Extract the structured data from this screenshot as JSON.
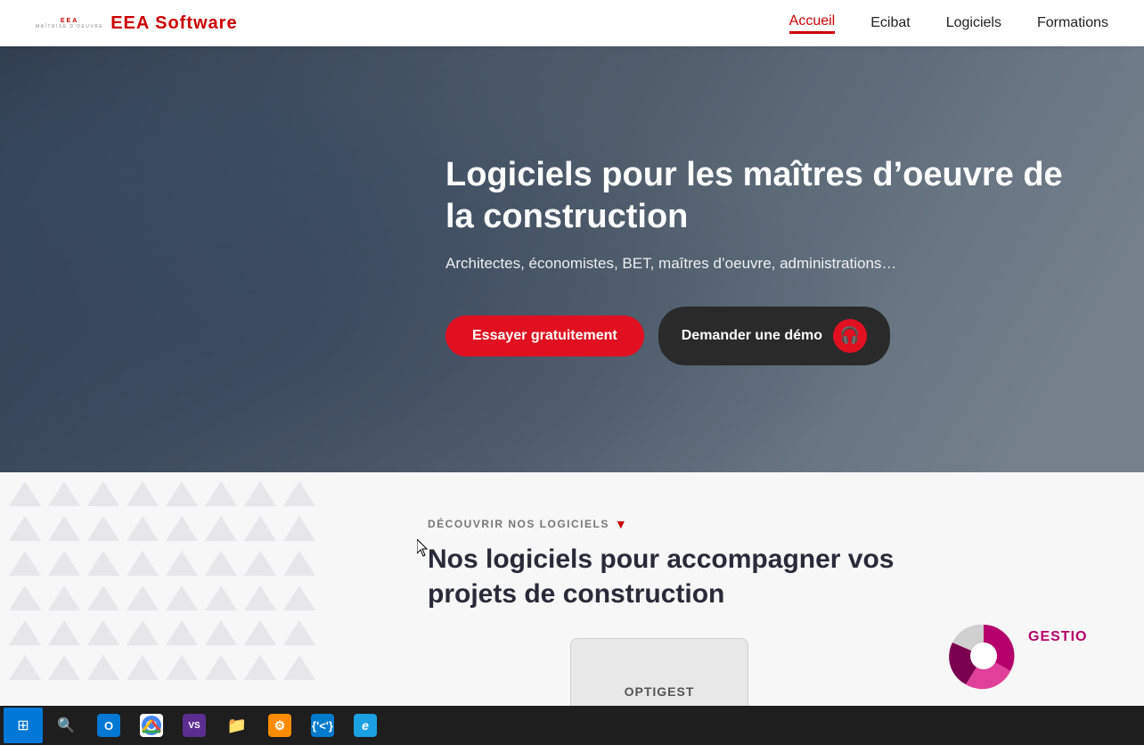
{
  "navbar": {
    "logo_top": "EEA",
    "logo_sub": "MAÎTRISE D'OEUVRE",
    "logo_text": "EEA Software",
    "nav_items": [
      {
        "id": "accueil",
        "label": "Accueil",
        "active": true
      },
      {
        "id": "ecibat",
        "label": "Ecibat",
        "active": false
      },
      {
        "id": "logiciels",
        "label": "Logiciels",
        "active": false
      },
      {
        "id": "formations",
        "label": "Formations",
        "active": false
      }
    ]
  },
  "hero": {
    "title": "Logiciels pour les maîtres d’oeuvre de la construction",
    "subtitle": "Architectes, économistes, BET, maîtres d’oeuvre, administrations…",
    "btn_primary": "Essayer gratuitement",
    "btn_demo": "Demander une démo",
    "demo_icon": "🎧"
  },
  "section": {
    "tag": "DÉCOUVRIR NOS LOGICIELS",
    "tag_icon": "▼",
    "title": "Nos logiciels pour accompagner vos projets de construction",
    "preview_optigest_label": "OPTIGEST",
    "preview_gestio_label": "GESTIO"
  },
  "taskbar": {
    "icons": [
      {
        "id": "windows",
        "symbol": "⊞",
        "color": "#0078d7"
      },
      {
        "id": "search",
        "symbol": "🔍",
        "color": "transparent"
      },
      {
        "id": "outlook",
        "symbol": "O",
        "color": "#0078d4"
      },
      {
        "id": "chrome",
        "symbol": "◉",
        "color": "#4caf50"
      },
      {
        "id": "visual-studio",
        "symbol": "VS",
        "color": "#5c2d91"
      },
      {
        "id": "folder",
        "symbol": "📁",
        "color": "transparent"
      },
      {
        "id": "devtools",
        "symbol": "⚙",
        "color": "#ff8c00"
      },
      {
        "id": "vscode",
        "symbol": "≷",
        "color": "#007acc"
      },
      {
        "id": "ie",
        "symbol": "e",
        "color": "#1ba1e2"
      }
    ]
  }
}
